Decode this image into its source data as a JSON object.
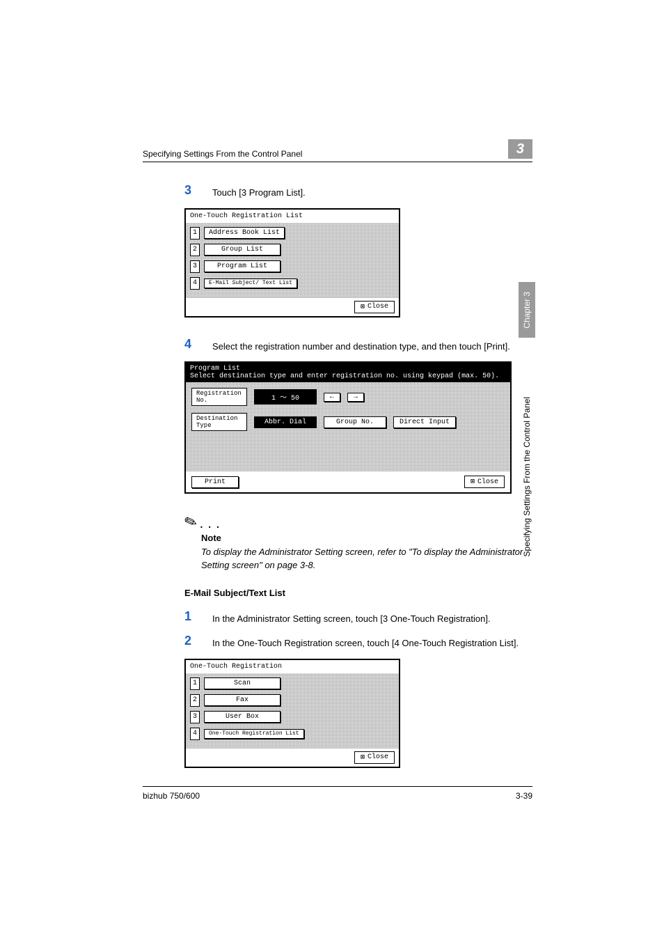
{
  "header": {
    "title": "Specifying Settings From the Control Panel",
    "chapter_num": "3"
  },
  "side": {
    "tab": "Chapter 3",
    "text": "Specifying Settings From the Control Panel"
  },
  "step3": {
    "num": "3",
    "text": "Touch [3 Program List]."
  },
  "ss1": {
    "title": "One-Touch Registration List",
    "items": {
      "n1": "1",
      "l1": "Address Book List",
      "n2": "2",
      "l2": "Group List",
      "n3": "3",
      "l3": "Program List",
      "n4": "4",
      "l4": "E-Mail Subject/\nText List"
    },
    "close": "Close"
  },
  "step4": {
    "num": "4",
    "text": "Select the registration number and destination type, and then touch [Print]."
  },
  "ss2": {
    "title": "Program List",
    "subtitle": "Select destination type and enter registration no. using keypad (max. 50).",
    "reg_label": "Registration\nNo.",
    "range": "1  ～   50",
    "arrow_l": "←",
    "arrow_r": "→",
    "dest_label": "Destination\nType",
    "d1": "Abbr. Dial",
    "d2": "Group No.",
    "d3": "Direct Input",
    "print": "Print",
    "close": "Close"
  },
  "note": {
    "label": "Note",
    "text": "To display the Administrator Setting screen, refer to \"To display the Administrator Setting screen\" on page 3-8."
  },
  "section_heading": "E-Mail Subject/Text List",
  "step1b": {
    "num": "1",
    "text": "In the Administrator Setting screen, touch [3 One-Touch Registration]."
  },
  "step2b": {
    "num": "2",
    "text": "In the One-Touch Registration screen, touch [4 One-Touch Registration List]."
  },
  "ss3": {
    "title": "One-Touch Registration",
    "items": {
      "n1": "1",
      "l1": "Scan",
      "n2": "2",
      "l2": "Fax",
      "n3": "3",
      "l3": "User Box",
      "n4": "4",
      "l4": "One-Touch\nRegistration List"
    },
    "close": "Close"
  },
  "footer": {
    "product": "bizhub 750/600",
    "page": "3-39"
  }
}
